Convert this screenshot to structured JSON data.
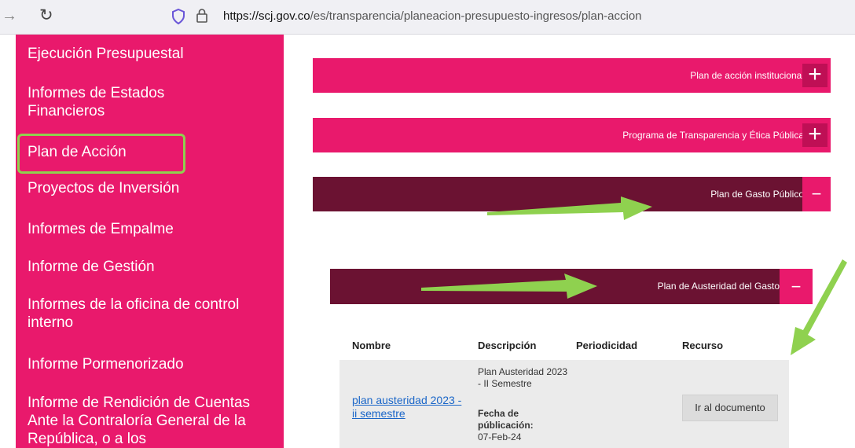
{
  "browser": {
    "url_host": "https://scj.gov.co",
    "url_path": "/es/transparencia/planeacion-presupuesto-ingresos/plan-accion"
  },
  "sidebar": {
    "items": [
      {
        "label": "Ejecución Presupuestal"
      },
      {
        "label": "Informes de Estados Financieros"
      },
      {
        "label": "Plan de Acción"
      },
      {
        "label": "Proyectos de Inversión"
      },
      {
        "label": "Informes de Empalme"
      },
      {
        "label": "Informe de Gestión"
      },
      {
        "label": "Informes de la oficina de control interno"
      },
      {
        "label": "Informe Pormenorizado"
      },
      {
        "label": "Informe de Rendición de Cuentas Ante la Contraloría General de la República, o a los"
      }
    ]
  },
  "accordions": [
    {
      "label": "Plan de acción institucional",
      "toggle": "+"
    },
    {
      "label": "Programa de Transparencia y Ética Pública",
      "toggle": "+"
    },
    {
      "label": "Plan de Gasto Público",
      "toggle": "−"
    },
    {
      "label": "Plan de Austeridad del Gasto",
      "toggle": "−"
    }
  ],
  "table": {
    "headers": [
      "Nombre",
      "Descripción",
      "Periodicidad",
      "Recurso"
    ],
    "rows": [
      {
        "name": "plan austeridad 2023 - ii semestre",
        "description": "Plan Austeridad 2023 - II Semestre",
        "fecha_label": "Fecha de públicación:",
        "fecha_value": "07-Feb-24",
        "periodicidad": "",
        "resource_button": "Ir al documento"
      }
    ]
  },
  "colors": {
    "brand_pink": "#e9196c",
    "brand_dark": "#6b1232",
    "highlight_green": "#8fd14f"
  }
}
